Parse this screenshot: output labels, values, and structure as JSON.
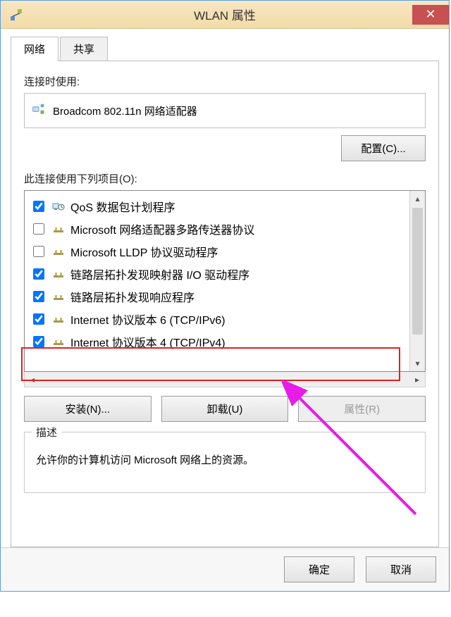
{
  "titlebar": {
    "title": "WLAN 属性"
  },
  "tabs": {
    "network": "网络",
    "sharing": "共享"
  },
  "connect_using_label": "连接时使用:",
  "adapter_name": "Broadcom 802.11n 网络适配器",
  "configure_btn": "配置(C)...",
  "items_label": "此连接使用下列项目(O):",
  "list": [
    {
      "checked": true,
      "icon": "qos",
      "label": "QoS 数据包计划程序"
    },
    {
      "checked": false,
      "icon": "proto",
      "label": "Microsoft 网络适配器多路传送器协议"
    },
    {
      "checked": false,
      "icon": "proto",
      "label": "Microsoft LLDP 协议驱动程序"
    },
    {
      "checked": true,
      "icon": "proto",
      "label": "链路层拓扑发现映射器 I/O 驱动程序"
    },
    {
      "checked": true,
      "icon": "proto",
      "label": "链路层拓扑发现响应程序"
    },
    {
      "checked": true,
      "icon": "proto",
      "label": "Internet 协议版本 6 (TCP/IPv6)"
    },
    {
      "checked": true,
      "icon": "proto",
      "label": "Internet 协议版本 4 (TCP/IPv4)"
    }
  ],
  "buttons": {
    "install": "安装(N)...",
    "uninstall": "卸载(U)",
    "properties": "属性(R)"
  },
  "description": {
    "legend": "描述",
    "text": "允许你的计算机访问 Microsoft 网络上的资源。"
  },
  "footer": {
    "ok": "确定",
    "cancel": "取消"
  }
}
